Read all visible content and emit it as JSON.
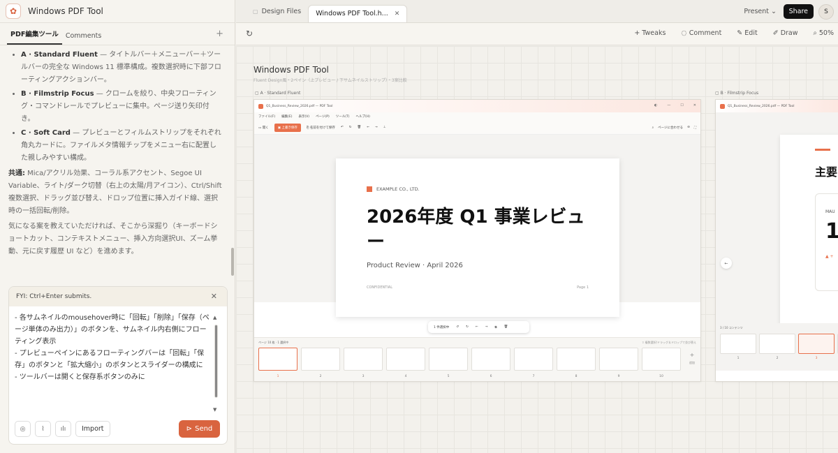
{
  "app": {
    "title": "Windows PDF Tool"
  },
  "left_tabs": [
    {
      "label": "PDF編集ツール"
    },
    {
      "label": "Comments"
    }
  ],
  "chat": {
    "bullets": [
      {
        "name": "A · Standard Fluent",
        "text": " — タイトルバー＋メニューバー＋ツールバーの完全な Windows 11 標準構成。複数選択時に下部フローティングアクションバー。"
      },
      {
        "name": "B · Filmstrip Focus",
        "text": " — クロームを絞り、中央フローティング・コマンドレールでプレビューに集中。ページ送り矢印付き。"
      },
      {
        "name": "C · Soft Card",
        "text": " — プレビューとフィルムストリップをそれぞれ角丸カードに。ファイルメタ情報チップをメニュー右に配置した親しみやすい構成。"
      }
    ],
    "common_label": "共通:",
    "common_text": " Mica/アクリル効果、コーラル系アクセント、Segoe UI Variable、ライト/ダーク切替（右上の太陽/月アイコン）、Ctrl/Shift 複数選択、ドラッグ並び替え、ドロップ位置に挿入ガイド線、選択時の一括回転/削除。",
    "closing": "気になる案を教えていただければ、そこから深掘り（キーボードショートカット、コンテキストメニュー、挿入方向選択UI、ズーム挙動、元に戻す履歴 UI など）を進めます。"
  },
  "composer": {
    "fyi": "FYI: Ctrl+Enter submits.",
    "text": "- 各サムネイルのmousehover時に「回転」「削除」「保存（ページ単体のみ出力）」のボタンを、サムネイル内右側にフローティング表示\n- プレビューペインにあるフローティングバーは「回転」「保存」のボタンと「拡大縮小」のボタンとスライダーの構成に\n- ツールバーは開くと保存系ボタンのみに",
    "import_label": "Import",
    "send_label": "Send"
  },
  "doc_tabs": [
    {
      "label": "Design Files"
    },
    {
      "label": "Windows PDF Tool.h..."
    }
  ],
  "topbar": {
    "present_label": "Present",
    "share_label": "Share",
    "avatar_initial": "S"
  },
  "toolbar": {
    "tweaks": "Tweaks",
    "comment": "Comment",
    "edit": "Edit",
    "draw": "Draw",
    "zoom": "50%"
  },
  "canvas": {
    "title": "Windows PDF Tool",
    "subtitle": "Fluent Design風・2ペイン（上プレビュー / 下サムネイルストリップ）・3案比較",
    "frame_a_label": "A · Standard Fluent",
    "frame_b_label": "B · Filmstrip Focus"
  },
  "frame_a": {
    "window_title": "Q1_Business_Review_2026.pdf — PDF Tool",
    "menus": [
      "ファイル(F)",
      "編集(E)",
      "表示(V)",
      "ページ(P)",
      "ツール(T)",
      "ヘルプ(H)"
    ],
    "tools": {
      "open": "開く",
      "save": "上書き保存",
      "save_as": "名前を付けて保存",
      "fit": "ページに合わせる"
    },
    "slide": {
      "company": "EXAMPLE CO., LTD.",
      "title": "2026年度 Q1 事業レビュー",
      "subtitle": "Product Review · April 2026",
      "confidential": "CONFIDENTIAL",
      "page": "Page 1"
    },
    "floating_selected": "1 件選択中",
    "strip_header": "ページ  10 枚 · 1 選択中",
    "strip_hint": "⇧ 複数選択/ドラッグ＆ドロップで並び替え",
    "add_label": "追加",
    "thumbs": [
      "1",
      "2",
      "3",
      "4",
      "5",
      "6",
      "7",
      "8",
      "9",
      "10"
    ]
  },
  "frame_b": {
    "window_title": "Q1_Business_Review_2026.pdf — PDF Tool",
    "heading": "主要",
    "metric_label": "MAU",
    "metric_value": "1",
    "delta": "▲ +",
    "strip_header": "3 / 10  コンテンツ",
    "thumbs": [
      "1",
      "2",
      "3",
      "4"
    ]
  }
}
